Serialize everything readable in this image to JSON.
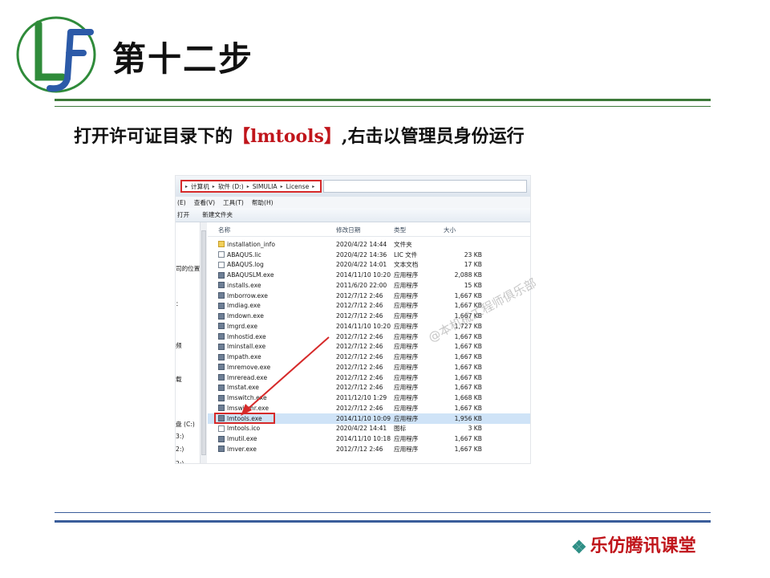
{
  "slide": {
    "title": "第十二步",
    "instruction_prefix": "打开许可证目录下的",
    "instruction_highlight": "【lmtools】",
    "instruction_suffix": ",右击以管理员身份运行",
    "brand": "乐仿腾讯课堂",
    "watermark": "@本机械工程师俱乐部"
  },
  "explorer": {
    "breadcrumb": [
      "计算机",
      "软件 (D:)",
      "SIMULIA",
      "License"
    ],
    "menu": [
      "(E)",
      "查看(V)",
      "工具(T)",
      "帮助(H)"
    ],
    "toolbar": [
      "打开",
      "新建文件夹"
    ],
    "nav_labels": [
      "司的位置",
      "：",
      "频",
      "载",
      "盘 (C:)",
      "3:)",
      "2:)",
      "2:)"
    ],
    "columns": {
      "name": "名称",
      "date": "修改日期",
      "type": "类型",
      "size": "大小"
    },
    "files": [
      {
        "name": "installation_info",
        "date": "2020/4/22 14:44",
        "type": "文件夹",
        "size": "",
        "icon": "folder"
      },
      {
        "name": "ABAQUS.lic",
        "date": "2020/4/22 14:36",
        "type": "LIC 文件",
        "size": "23 KB",
        "icon": "doc"
      },
      {
        "name": "ABAQUS.log",
        "date": "2020/4/22 14:01",
        "type": "文本文档",
        "size": "17 KB",
        "icon": "doc"
      },
      {
        "name": "ABAQUSLM.exe",
        "date": "2014/11/10 10:20",
        "type": "应用程序",
        "size": "2,088 KB",
        "icon": "exe"
      },
      {
        "name": "installs.exe",
        "date": "2011/6/20 22:00",
        "type": "应用程序",
        "size": "15 KB",
        "icon": "exe"
      },
      {
        "name": "lmborrow.exe",
        "date": "2012/7/12 2:46",
        "type": "应用程序",
        "size": "1,667 KB",
        "icon": "exe"
      },
      {
        "name": "lmdiag.exe",
        "date": "2012/7/12 2:46",
        "type": "应用程序",
        "size": "1,667 KB",
        "icon": "exe"
      },
      {
        "name": "lmdown.exe",
        "date": "2012/7/12 2:46",
        "type": "应用程序",
        "size": "1,667 KB",
        "icon": "exe"
      },
      {
        "name": "lmgrd.exe",
        "date": "2014/11/10 10:20",
        "type": "应用程序",
        "size": "1,727 KB",
        "icon": "exe"
      },
      {
        "name": "lmhostid.exe",
        "date": "2012/7/12 2:46",
        "type": "应用程序",
        "size": "1,667 KB",
        "icon": "exe"
      },
      {
        "name": "lminstall.exe",
        "date": "2012/7/12 2:46",
        "type": "应用程序",
        "size": "1,667 KB",
        "icon": "exe"
      },
      {
        "name": "lmpath.exe",
        "date": "2012/7/12 2:46",
        "type": "应用程序",
        "size": "1,667 KB",
        "icon": "exe"
      },
      {
        "name": "lmremove.exe",
        "date": "2012/7/12 2:46",
        "type": "应用程序",
        "size": "1,667 KB",
        "icon": "exe"
      },
      {
        "name": "lmreread.exe",
        "date": "2012/7/12 2:46",
        "type": "应用程序",
        "size": "1,667 KB",
        "icon": "exe"
      },
      {
        "name": "lmstat.exe",
        "date": "2012/7/12 2:46",
        "type": "应用程序",
        "size": "1,667 KB",
        "icon": "exe"
      },
      {
        "name": "lmswitch.exe",
        "date": "2011/12/10 1:29",
        "type": "应用程序",
        "size": "1,668 KB",
        "icon": "exe"
      },
      {
        "name": "lmswitchr.exe",
        "date": "2012/7/12 2:46",
        "type": "应用程序",
        "size": "1,667 KB",
        "icon": "exe"
      },
      {
        "name": "lmtools.exe",
        "date": "2014/11/10 10:09",
        "type": "应用程序",
        "size": "1,956 KB",
        "icon": "exe",
        "selected": true,
        "highlight": true
      },
      {
        "name": "lmtools.ico",
        "date": "2020/4/22 14:41",
        "type": "图标",
        "size": "3 KB",
        "icon": "doc"
      },
      {
        "name": "lmutil.exe",
        "date": "2014/11/10 10:18",
        "type": "应用程序",
        "size": "1,667 KB",
        "icon": "exe"
      },
      {
        "name": "lmver.exe",
        "date": "2012/7/12 2:46",
        "type": "应用程序",
        "size": "1,667 KB",
        "icon": "exe"
      }
    ]
  },
  "colors": {
    "green_rule": "#3d7a3a",
    "blue_rule": "#3a5d9a",
    "accent_red": "#c0151b",
    "annotation_red": "#d62a2a",
    "selection": "#cfe3f7"
  }
}
